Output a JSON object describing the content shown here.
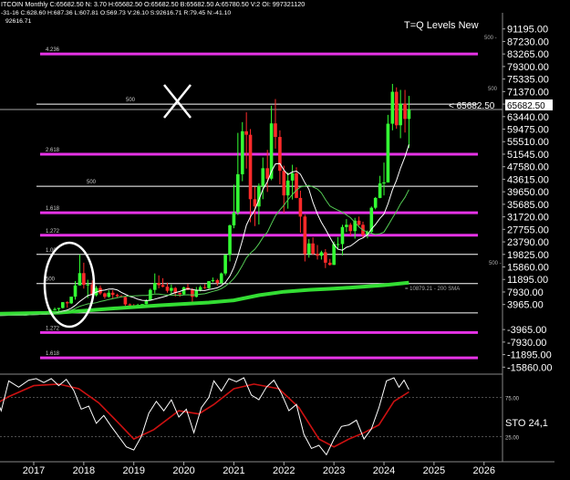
{
  "header": {
    "line1": "ITCOIN Monthly  C:65682.50  N: 3.70  H:65682.50  O:65682.50  B:65682.50  A:65780.50  V:2  OI: 997321120",
    "line2": "-31-16  C:628.60  H:687.36  L:607.81  O:569.73  V:26.10  S:92616.71  R:79.45  N:-41.10",
    "line3": "92616.71"
  },
  "annotation": {
    "title": "T=Q Levels New",
    "price_marker": "< 65682.50",
    "current_price": "65682.50",
    "sma_label": "= 10879.21 - 200 SMA"
  },
  "colors": {
    "background": "#000000",
    "up_candle": "#33ff33",
    "down_candle": "#ff2a2a",
    "level_magenta": "#e633e6",
    "level_white": "#ffffff",
    "sma200": "#33dd33",
    "sma_fast": "#ffffff",
    "sma_mid": "#55cc55",
    "stoch_k": "#ffffff",
    "stoch_d": "#cc1111"
  },
  "price_axis": [
    "91195.00",
    "87230.00",
    "83265.00",
    "79300.00",
    "75335.00",
    "71370.00",
    "67405.00",
    "63440.00",
    "59475.00",
    "55510.00",
    "51545.00",
    "47580.00",
    "43615.00",
    "39650.00",
    "35685.00",
    "31720.00",
    "27755.00",
    "23790.00",
    "19825.00",
    "15860.00",
    "11895.00",
    "7930.00",
    "3965.00",
    "-3965.00",
    "-7930.00",
    "-11895.00",
    "-15860.00"
  ],
  "stoch_axis": [
    "75.00",
    "25.00"
  ],
  "stoch_label": "STO  24,1",
  "x_axis": [
    "2017",
    "2018",
    "2019",
    "2020",
    "2021",
    "2022",
    "2023",
    "2024",
    "2025",
    "2026"
  ],
  "levels": [
    {
      "label": "4.236",
      "price": 83265,
      "color": "magenta"
    },
    {
      "label": "500",
      "price": 67405,
      "color": "white"
    },
    {
      "label": "2.618",
      "price": 51545,
      "color": "magenta"
    },
    {
      "label": "500",
      "price": 41400,
      "color": "white"
    },
    {
      "label": "1.618",
      "price": 33000,
      "color": "magenta"
    },
    {
      "label": "1.272",
      "price": 25900,
      "color": "magenta"
    },
    {
      "label": "1.00",
      "price": 19825,
      "color": "white"
    },
    {
      "label": "500",
      "price": 10600,
      "color": "white"
    },
    {
      "label": "",
      "price": 1300,
      "color": "white"
    },
    {
      "label": "1.272",
      "price": -4900,
      "color": "magenta"
    },
    {
      "label": "1.618",
      "price": -12900,
      "color": "magenta"
    }
  ],
  "edge_marks": [
    "500 -",
    "500",
    "500 -"
  ],
  "chart_data": {
    "type": "candlestick",
    "title": "T=Q Levels New",
    "symbol": "BITCOIN Monthly",
    "ylim": [
      -17500,
      94000
    ],
    "candles": [
      {
        "t": 2016.0,
        "o": 430,
        "h": 460,
        "l": 360,
        "c": 380
      },
      {
        "t": 2016.5,
        "o": 620,
        "h": 780,
        "l": 480,
        "c": 700
      },
      {
        "t": 2016.83,
        "o": 700,
        "h": 760,
        "l": 690,
        "c": 740
      },
      {
        "t": 2016.92,
        "o": 740,
        "h": 990,
        "l": 735,
        "c": 960
      },
      {
        "t": 2017.0,
        "o": 960,
        "h": 1160,
        "l": 760,
        "c": 970
      },
      {
        "t": 2017.08,
        "o": 970,
        "h": 1200,
        "l": 900,
        "c": 1190
      },
      {
        "t": 2017.17,
        "o": 1190,
        "h": 1350,
        "l": 890,
        "c": 1080
      },
      {
        "t": 2017.25,
        "o": 1080,
        "h": 1450,
        "l": 1080,
        "c": 1350
      },
      {
        "t": 2017.33,
        "o": 1350,
        "h": 2750,
        "l": 1350,
        "c": 2300
      },
      {
        "t": 2017.42,
        "o": 2300,
        "h": 3000,
        "l": 2100,
        "c": 2500
      },
      {
        "t": 2017.5,
        "o": 2500,
        "h": 2900,
        "l": 1830,
        "c": 2870
      },
      {
        "t": 2017.58,
        "o": 2870,
        "h": 4750,
        "l": 2700,
        "c": 4700
      },
      {
        "t": 2017.67,
        "o": 4700,
        "h": 4980,
        "l": 2950,
        "c": 4340
      },
      {
        "t": 2017.75,
        "o": 4340,
        "h": 6470,
        "l": 4110,
        "c": 6450
      },
      {
        "t": 2017.83,
        "o": 6450,
        "h": 11400,
        "l": 5500,
        "c": 10000
      },
      {
        "t": 2017.92,
        "o": 10000,
        "h": 19800,
        "l": 10000,
        "c": 13900
      },
      {
        "t": 2018.0,
        "o": 13900,
        "h": 17200,
        "l": 9000,
        "c": 10200
      },
      {
        "t": 2018.08,
        "o": 10200,
        "h": 11800,
        "l": 6000,
        "c": 10300
      },
      {
        "t": 2018.17,
        "o": 10300,
        "h": 11600,
        "l": 6600,
        "c": 6900
      },
      {
        "t": 2018.25,
        "o": 6900,
        "h": 9800,
        "l": 6500,
        "c": 9200
      },
      {
        "t": 2018.33,
        "o": 9200,
        "h": 10000,
        "l": 7000,
        "c": 7500
      },
      {
        "t": 2018.42,
        "o": 7500,
        "h": 7800,
        "l": 5800,
        "c": 6400
      },
      {
        "t": 2018.5,
        "o": 6400,
        "h": 8500,
        "l": 6100,
        "c": 7700
      },
      {
        "t": 2018.58,
        "o": 7700,
        "h": 8500,
        "l": 5900,
        "c": 7000
      },
      {
        "t": 2018.67,
        "o": 7000,
        "h": 7400,
        "l": 6100,
        "c": 6600
      },
      {
        "t": 2018.75,
        "o": 6600,
        "h": 7000,
        "l": 6200,
        "c": 6300
      },
      {
        "t": 2018.83,
        "o": 6300,
        "h": 6600,
        "l": 3500,
        "c": 4000
      },
      {
        "t": 2018.92,
        "o": 4000,
        "h": 4300,
        "l": 3100,
        "c": 3700
      },
      {
        "t": 2019.0,
        "o": 3700,
        "h": 4100,
        "l": 3300,
        "c": 3450
      },
      {
        "t": 2019.08,
        "o": 3450,
        "h": 4200,
        "l": 3400,
        "c": 3800
      },
      {
        "t": 2019.17,
        "o": 3800,
        "h": 4100,
        "l": 3700,
        "c": 4100
      },
      {
        "t": 2019.25,
        "o": 4100,
        "h": 5600,
        "l": 4100,
        "c": 5300
      },
      {
        "t": 2019.33,
        "o": 5300,
        "h": 9000,
        "l": 5300,
        "c": 8600
      },
      {
        "t": 2019.42,
        "o": 8600,
        "h": 13800,
        "l": 7500,
        "c": 10800
      },
      {
        "t": 2019.5,
        "o": 10800,
        "h": 13200,
        "l": 9100,
        "c": 10100
      },
      {
        "t": 2019.58,
        "o": 10100,
        "h": 12300,
        "l": 9400,
        "c": 9600
      },
      {
        "t": 2019.67,
        "o": 9600,
        "h": 10900,
        "l": 7700,
        "c": 8300
      },
      {
        "t": 2019.75,
        "o": 8300,
        "h": 10300,
        "l": 7300,
        "c": 9200
      },
      {
        "t": 2019.83,
        "o": 9200,
        "h": 9500,
        "l": 6500,
        "c": 7600
      },
      {
        "t": 2019.92,
        "o": 7600,
        "h": 7800,
        "l": 6400,
        "c": 7200
      },
      {
        "t": 2020.0,
        "o": 7200,
        "h": 9600,
        "l": 6900,
        "c": 9400
      },
      {
        "t": 2020.08,
        "o": 9400,
        "h": 10500,
        "l": 8500,
        "c": 8600
      },
      {
        "t": 2020.17,
        "o": 8600,
        "h": 9200,
        "l": 3800,
        "c": 6400
      },
      {
        "t": 2020.25,
        "o": 6400,
        "h": 9500,
        "l": 6200,
        "c": 8600
      },
      {
        "t": 2020.33,
        "o": 8600,
        "h": 10000,
        "l": 8100,
        "c": 9450
      },
      {
        "t": 2020.42,
        "o": 9450,
        "h": 10400,
        "l": 8900,
        "c": 9150
      },
      {
        "t": 2020.5,
        "o": 9150,
        "h": 11400,
        "l": 8900,
        "c": 11350
      },
      {
        "t": 2020.58,
        "o": 11350,
        "h": 12500,
        "l": 11000,
        "c": 11650
      },
      {
        "t": 2020.67,
        "o": 11650,
        "h": 12100,
        "l": 9900,
        "c": 10800
      },
      {
        "t": 2020.75,
        "o": 10800,
        "h": 14100,
        "l": 10400,
        "c": 13800
      },
      {
        "t": 2020.83,
        "o": 13800,
        "h": 19800,
        "l": 13200,
        "c": 19700
      },
      {
        "t": 2020.92,
        "o": 19700,
        "h": 29300,
        "l": 17600,
        "c": 29000
      },
      {
        "t": 2021.0,
        "o": 29000,
        "h": 41900,
        "l": 28100,
        "c": 33100
      },
      {
        "t": 2021.08,
        "o": 33100,
        "h": 58300,
        "l": 32300,
        "c": 45200
      },
      {
        "t": 2021.17,
        "o": 45200,
        "h": 61700,
        "l": 43000,
        "c": 58800
      },
      {
        "t": 2021.25,
        "o": 58800,
        "h": 64800,
        "l": 47000,
        "c": 57700
      },
      {
        "t": 2021.33,
        "o": 57700,
        "h": 59500,
        "l": 30000,
        "c": 37300
      },
      {
        "t": 2021.42,
        "o": 37300,
        "h": 41300,
        "l": 28800,
        "c": 35000
      },
      {
        "t": 2021.5,
        "o": 35000,
        "h": 42300,
        "l": 29300,
        "c": 41500
      },
      {
        "t": 2021.58,
        "o": 41500,
        "h": 50500,
        "l": 37300,
        "c": 47100
      },
      {
        "t": 2021.67,
        "o": 47100,
        "h": 52900,
        "l": 39600,
        "c": 43800
      },
      {
        "t": 2021.75,
        "o": 43800,
        "h": 66900,
        "l": 43300,
        "c": 61300
      },
      {
        "t": 2021.83,
        "o": 61300,
        "h": 69000,
        "l": 53300,
        "c": 57000
      },
      {
        "t": 2021.92,
        "o": 57000,
        "h": 59100,
        "l": 42000,
        "c": 46300
      },
      {
        "t": 2022.0,
        "o": 46300,
        "h": 47900,
        "l": 33000,
        "c": 38500
      },
      {
        "t": 2022.08,
        "o": 38500,
        "h": 45800,
        "l": 34300,
        "c": 43200
      },
      {
        "t": 2022.17,
        "o": 43200,
        "h": 48200,
        "l": 37200,
        "c": 45500
      },
      {
        "t": 2022.25,
        "o": 45500,
        "h": 47400,
        "l": 37600,
        "c": 37700
      },
      {
        "t": 2022.33,
        "o": 37700,
        "h": 40000,
        "l": 26700,
        "c": 31800
      },
      {
        "t": 2022.42,
        "o": 31800,
        "h": 32400,
        "l": 17600,
        "c": 19900
      },
      {
        "t": 2022.5,
        "o": 19900,
        "h": 24700,
        "l": 18800,
        "c": 23300
      },
      {
        "t": 2022.58,
        "o": 23300,
        "h": 25200,
        "l": 19600,
        "c": 20000
      },
      {
        "t": 2022.67,
        "o": 20000,
        "h": 22800,
        "l": 18200,
        "c": 19400
      },
      {
        "t": 2022.75,
        "o": 19400,
        "h": 21000,
        "l": 18200,
        "c": 20500
      },
      {
        "t": 2022.83,
        "o": 20500,
        "h": 21500,
        "l": 15500,
        "c": 17200
      },
      {
        "t": 2022.92,
        "o": 17200,
        "h": 18400,
        "l": 16300,
        "c": 16500
      },
      {
        "t": 2023.0,
        "o": 16500,
        "h": 23900,
        "l": 16500,
        "c": 23100
      },
      {
        "t": 2023.08,
        "o": 23100,
        "h": 25300,
        "l": 21400,
        "c": 23100
      },
      {
        "t": 2023.17,
        "o": 23100,
        "h": 29200,
        "l": 19500,
        "c": 28500
      },
      {
        "t": 2023.25,
        "o": 28500,
        "h": 31000,
        "l": 26900,
        "c": 29200
      },
      {
        "t": 2023.33,
        "o": 29200,
        "h": 29800,
        "l": 25800,
        "c": 27200
      },
      {
        "t": 2023.42,
        "o": 27200,
        "h": 31400,
        "l": 24800,
        "c": 30500
      },
      {
        "t": 2023.5,
        "o": 30500,
        "h": 31800,
        "l": 28900,
        "c": 29200
      },
      {
        "t": 2023.58,
        "o": 29200,
        "h": 30200,
        "l": 25300,
        "c": 26000
      },
      {
        "t": 2023.67,
        "o": 26000,
        "h": 27400,
        "l": 24900,
        "c": 27000
      },
      {
        "t": 2023.75,
        "o": 27000,
        "h": 35000,
        "l": 26600,
        "c": 34600
      },
      {
        "t": 2023.83,
        "o": 34600,
        "h": 38000,
        "l": 34100,
        "c": 37700
      },
      {
        "t": 2023.92,
        "o": 37700,
        "h": 44700,
        "l": 37600,
        "c": 42300
      },
      {
        "t": 2024.0,
        "o": 42300,
        "h": 48900,
        "l": 38500,
        "c": 42600
      },
      {
        "t": 2024.08,
        "o": 42600,
        "h": 64000,
        "l": 42600,
        "c": 61200
      },
      {
        "t": 2024.17,
        "o": 61200,
        "h": 73800,
        "l": 59100,
        "c": 71300
      },
      {
        "t": 2024.25,
        "o": 71300,
        "h": 72700,
        "l": 59600,
        "c": 60700
      },
      {
        "t": 2024.33,
        "o": 60700,
        "h": 71900,
        "l": 56600,
        "c": 67500
      },
      {
        "t": 2024.42,
        "o": 67500,
        "h": 71900,
        "l": 58400,
        "c": 62700
      },
      {
        "t": 2024.5,
        "o": 62700,
        "h": 70000,
        "l": 53500,
        "c": 65682.5
      }
    ],
    "sma200": [
      [
        2016.0,
        1000
      ],
      [
        2017.5,
        1400
      ],
      [
        2018.5,
        2600
      ],
      [
        2019.5,
        3700
      ],
      [
        2020.5,
        4600
      ],
      [
        2021.0,
        5300
      ],
      [
        2021.5,
        6900
      ],
      [
        2022.0,
        8000
      ],
      [
        2022.5,
        8600
      ],
      [
        2023.0,
        9000
      ],
      [
        2023.5,
        9500
      ],
      [
        2024.0,
        10100
      ],
      [
        2024.5,
        10879
      ]
    ],
    "stoch_k": [
      [
        2016.0,
        70
      ],
      [
        2016.2,
        82
      ],
      [
        2016.35,
        58
      ],
      [
        2016.5,
        96
      ],
      [
        2016.7,
        88
      ],
      [
        2016.9,
        97
      ],
      [
        2017.05,
        99
      ],
      [
        2017.2,
        94
      ],
      [
        2017.35,
        99
      ],
      [
        2017.5,
        90
      ],
      [
        2017.65,
        98
      ],
      [
        2017.8,
        84
      ],
      [
        2017.95,
        60
      ],
      [
        2018.1,
        64
      ],
      [
        2018.25,
        42
      ],
      [
        2018.4,
        52
      ],
      [
        2018.55,
        38
      ],
      [
        2018.7,
        25
      ],
      [
        2018.85,
        12
      ],
      [
        2019.0,
        8
      ],
      [
        2019.15,
        25
      ],
      [
        2019.3,
        55
      ],
      [
        2019.45,
        70
      ],
      [
        2019.6,
        58
      ],
      [
        2019.75,
        72
      ],
      [
        2019.9,
        50
      ],
      [
        2020.05,
        60
      ],
      [
        2020.2,
        30
      ],
      [
        2020.35,
        62
      ],
      [
        2020.5,
        75
      ],
      [
        2020.6,
        96
      ],
      [
        2020.75,
        83
      ],
      [
        2020.9,
        99
      ],
      [
        2021.05,
        95
      ],
      [
        2021.2,
        100
      ],
      [
        2021.35,
        78
      ],
      [
        2021.5,
        72
      ],
      [
        2021.65,
        88
      ],
      [
        2021.8,
        97
      ],
      [
        2021.95,
        80
      ],
      [
        2022.1,
        58
      ],
      [
        2022.25,
        66
      ],
      [
        2022.4,
        28
      ],
      [
        2022.55,
        10
      ],
      [
        2022.7,
        14
      ],
      [
        2022.85,
        2
      ],
      [
        2023.0,
        22
      ],
      [
        2023.15,
        38
      ],
      [
        2023.3,
        40
      ],
      [
        2023.45,
        46
      ],
      [
        2023.6,
        22
      ],
      [
        2023.75,
        35
      ],
      [
        2023.9,
        62
      ],
      [
        2024.05,
        96
      ],
      [
        2024.2,
        100
      ],
      [
        2024.3,
        88
      ],
      [
        2024.4,
        97
      ],
      [
        2024.5,
        85
      ]
    ],
    "stoch_d": [
      [
        2016.0,
        58
      ],
      [
        2016.5,
        76
      ],
      [
        2017.0,
        90
      ],
      [
        2017.5,
        92
      ],
      [
        2017.9,
        86
      ],
      [
        2018.3,
        68
      ],
      [
        2018.7,
        42
      ],
      [
        2019.0,
        22
      ],
      [
        2019.4,
        34
      ],
      [
        2019.9,
        58
      ],
      [
        2020.3,
        54
      ],
      [
        2020.6,
        66
      ],
      [
        2021.0,
        86
      ],
      [
        2021.4,
        92
      ],
      [
        2021.9,
        86
      ],
      [
        2022.3,
        62
      ],
      [
        2022.7,
        22
      ],
      [
        2023.0,
        12
      ],
      [
        2023.3,
        22
      ],
      [
        2023.6,
        30
      ],
      [
        2023.9,
        40
      ],
      [
        2024.2,
        70
      ],
      [
        2024.5,
        82
      ]
    ]
  }
}
